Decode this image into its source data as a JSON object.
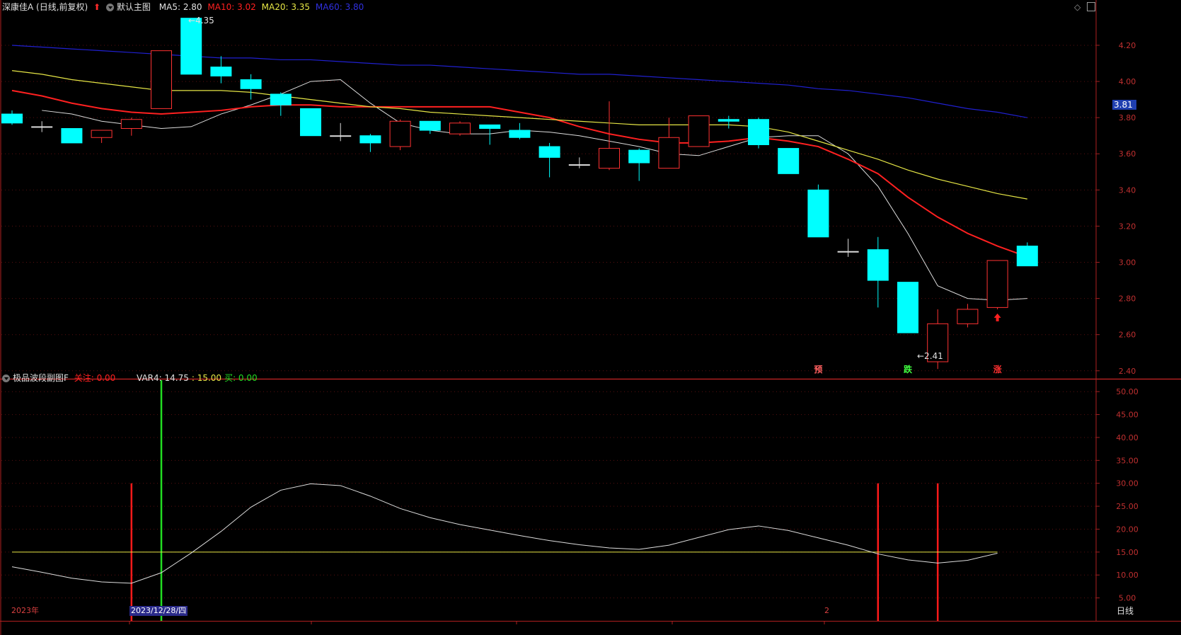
{
  "header": {
    "stock_title": "深康佳A (日线,前复权)",
    "main_chart_label": "默认主图",
    "ma5_label": "MA5: 2.80",
    "ma10_label": "MA10: 3.02",
    "ma20_label": "MA20: 3.35",
    "ma60_label": "MA60: 3.80"
  },
  "sub_header": {
    "indicator_name": "极品波段副图F",
    "watch_label": "关注: 0.00",
    "var4_label": "VAR4: 14.75",
    "level_label": ": 15.00",
    "buy_label": "买: 0.00"
  },
  "annotations": {
    "high_label": "4.35",
    "low_label": "←2.41",
    "current_price": "3.81",
    "signal_yu": "预",
    "signal_die": "跌",
    "signal_zhang": "涨"
  },
  "bottom_bar": {
    "year_label": "2023年",
    "date_cursor": "2023/12/28/四",
    "month_label": "2",
    "period_label": "日线"
  },
  "colors": {
    "up": "#ff3232",
    "down": "#00ffff",
    "ma5": "#dddddd",
    "ma10": "#ff2020",
    "ma20": "#e5e545",
    "ma60": "#2020d0",
    "osc": "#dddddd",
    "level": "#e5e545",
    "sig_red": "#ff1a1a",
    "sig_green": "#22dd22"
  },
  "chart_data": [
    {
      "type": "candlestick",
      "title": "深康佳A (日线,前复权)",
      "ylim": [
        2.36,
        4.38
      ],
      "yticks": [
        2.4,
        2.6,
        2.8,
        3.0,
        3.2,
        3.4,
        3.6,
        3.8,
        4.0,
        4.2
      ],
      "candles": [
        {
          "o": 3.82,
          "h": 3.84,
          "l": 3.76,
          "c": 3.77
        },
        {
          "o": 3.75,
          "h": 3.78,
          "l": 3.72,
          "c": 3.75
        },
        {
          "o": 3.74,
          "h": 3.74,
          "l": 3.66,
          "c": 3.66
        },
        {
          "o": 3.69,
          "h": 3.73,
          "l": 3.66,
          "c": 3.73
        },
        {
          "o": 3.74,
          "h": 3.8,
          "l": 3.7,
          "c": 3.79
        },
        {
          "o": 3.85,
          "h": 4.17,
          "l": 3.85,
          "c": 4.17
        },
        {
          "o": 4.35,
          "h": 4.35,
          "l": 4.04,
          "c": 4.04
        },
        {
          "o": 4.08,
          "h": 4.14,
          "l": 3.99,
          "c": 4.03
        },
        {
          "o": 4.01,
          "h": 4.04,
          "l": 3.9,
          "c": 3.96
        },
        {
          "o": 3.93,
          "h": 3.94,
          "l": 3.81,
          "c": 3.87
        },
        {
          "o": 3.85,
          "h": 3.85,
          "l": 3.7,
          "c": 3.7
        },
        {
          "o": 3.7,
          "h": 3.77,
          "l": 3.67,
          "c": 3.7
        },
        {
          "o": 3.7,
          "h": 3.71,
          "l": 3.61,
          "c": 3.66
        },
        {
          "o": 3.64,
          "h": 3.79,
          "l": 3.62,
          "c": 3.78
        },
        {
          "o": 3.78,
          "h": 3.78,
          "l": 3.71,
          "c": 3.73
        },
        {
          "o": 3.71,
          "h": 3.78,
          "l": 3.7,
          "c": 3.77
        },
        {
          "o": 3.76,
          "h": 3.76,
          "l": 3.65,
          "c": 3.74
        },
        {
          "o": 3.73,
          "h": 3.77,
          "l": 3.68,
          "c": 3.69
        },
        {
          "o": 3.64,
          "h": 3.66,
          "l": 3.47,
          "c": 3.58
        },
        {
          "o": 3.54,
          "h": 3.58,
          "l": 3.52,
          "c": 3.54
        },
        {
          "o": 3.52,
          "h": 3.89,
          "l": 3.51,
          "c": 3.63
        },
        {
          "o": 3.62,
          "h": 3.63,
          "l": 3.45,
          "c": 3.55
        },
        {
          "o": 3.52,
          "h": 3.8,
          "l": 3.52,
          "c": 3.69
        },
        {
          "o": 3.64,
          "h": 3.81,
          "l": 3.64,
          "c": 3.81
        },
        {
          "o": 3.79,
          "h": 3.81,
          "l": 3.74,
          "c": 3.78
        },
        {
          "o": 3.79,
          "h": 3.8,
          "l": 3.63,
          "c": 3.65
        },
        {
          "o": 3.63,
          "h": 3.63,
          "l": 3.49,
          "c": 3.49
        },
        {
          "o": 3.4,
          "h": 3.43,
          "l": 3.14,
          "c": 3.14
        },
        {
          "o": 3.06,
          "h": 3.13,
          "l": 3.03,
          "c": 3.06
        },
        {
          "o": 3.07,
          "h": 3.14,
          "l": 2.75,
          "c": 2.9
        },
        {
          "o": 2.89,
          "h": 2.89,
          "l": 2.61,
          "c": 2.61
        },
        {
          "o": 2.45,
          "h": 2.74,
          "l": 2.41,
          "c": 2.66
        },
        {
          "o": 2.66,
          "h": 2.77,
          "l": 2.64,
          "c": 2.74
        },
        {
          "o": 2.75,
          "h": 3.01,
          "l": 2.74,
          "c": 3.01
        },
        {
          "o": 3.09,
          "h": 3.11,
          "l": 2.98,
          "c": 2.98
        }
      ],
      "ma": {
        "MA5": [
          3.84,
          3.82,
          3.78,
          3.76,
          3.74,
          3.75,
          3.82,
          3.87,
          3.93,
          4.0,
          4.01,
          3.88,
          3.77,
          3.73,
          3.71,
          3.71,
          3.73,
          3.72,
          3.7,
          3.67,
          3.64,
          3.6,
          3.59,
          3.64,
          3.69,
          3.7,
          3.7,
          3.6,
          3.42,
          3.16,
          2.87,
          2.8,
          2.79,
          2.8
        ],
        "MA10": [
          3.95,
          3.92,
          3.88,
          3.85,
          3.83,
          3.82,
          3.83,
          3.84,
          3.86,
          3.87,
          3.87,
          3.86,
          3.86,
          3.86,
          3.86,
          3.86,
          3.86,
          3.83,
          3.8,
          3.75,
          3.71,
          3.68,
          3.66,
          3.66,
          3.67,
          3.69,
          3.67,
          3.64,
          3.57,
          3.49,
          3.36,
          3.25,
          3.16,
          3.09,
          3.03
        ],
        "MA20": [
          4.06,
          4.04,
          4.01,
          3.99,
          3.97,
          3.95,
          3.95,
          3.95,
          3.94,
          3.92,
          3.9,
          3.88,
          3.86,
          3.85,
          3.83,
          3.82,
          3.81,
          3.8,
          3.79,
          3.78,
          3.77,
          3.76,
          3.76,
          3.76,
          3.76,
          3.75,
          3.72,
          3.67,
          3.62,
          3.57,
          3.51,
          3.46,
          3.42,
          3.38,
          3.35
        ],
        "MA60": [
          4.2,
          4.19,
          4.18,
          4.17,
          4.16,
          4.15,
          4.14,
          4.13,
          4.13,
          4.12,
          4.12,
          4.11,
          4.1,
          4.09,
          4.09,
          4.08,
          4.07,
          4.06,
          4.05,
          4.04,
          4.04,
          4.03,
          4.02,
          4.01,
          4.0,
          3.99,
          3.98,
          3.96,
          3.95,
          3.93,
          3.91,
          3.88,
          3.85,
          3.83,
          3.8
        ]
      },
      "signals": [
        {
          "index": 27,
          "text": "预"
        },
        {
          "index": 30,
          "text": "跌"
        },
        {
          "index": 33,
          "text": "涨"
        }
      ],
      "up_arrow_index": 33
    },
    {
      "type": "line",
      "title": "极品波段副图F",
      "ylim": [
        0,
        52.5
      ],
      "yticks": [
        5,
        10,
        15,
        20,
        25,
        30,
        35,
        40,
        45,
        50
      ],
      "var4": [
        11.8,
        10.6,
        9.3,
        8.5,
        8.2,
        10.5,
        14.8,
        19.5,
        24.8,
        28.5,
        29.9,
        29.5,
        27.2,
        24.5,
        22.5,
        21.0,
        19.8,
        18.6,
        17.5,
        16.6,
        15.9,
        15.6,
        16.5,
        18.2,
        19.9,
        20.7,
        19.7,
        18.1,
        16.5,
        14.6,
        13.3,
        12.6,
        13.2,
        14.75
      ],
      "level": 15.0,
      "red_signals": [
        4,
        29,
        31
      ],
      "green_signals": [
        5
      ],
      "signal_top": 30,
      "green_signal_top": 52.5
    }
  ]
}
